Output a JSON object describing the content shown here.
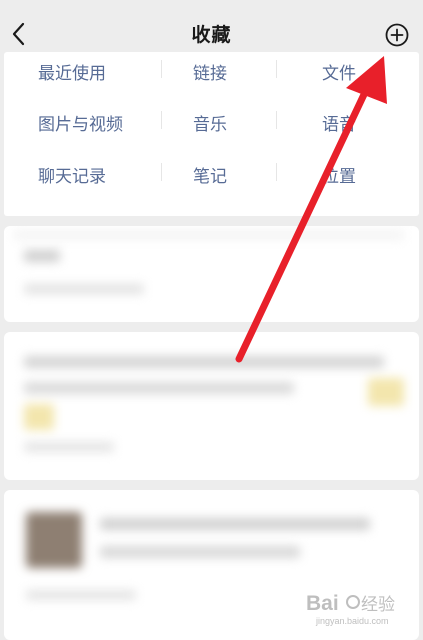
{
  "header": {
    "title": "收藏",
    "back_icon": "chevron-left-icon",
    "add_icon": "circle-plus-icon"
  },
  "categories": [
    {
      "label": "最近使用"
    },
    {
      "label": "链接"
    },
    {
      "label": "文件"
    },
    {
      "label": "图片与视频"
    },
    {
      "label": "音乐"
    },
    {
      "label": "语音"
    },
    {
      "label": "聊天记录"
    },
    {
      "label": "笔记"
    },
    {
      "label": "位置"
    }
  ],
  "annotation": {
    "arrow_color": "#e8202a"
  },
  "watermark": {
    "text": "Baidu经验",
    "url": "jingyan.baidu.com"
  },
  "colors": {
    "background": "#ededed",
    "category_text": "#576b95",
    "title_text": "#191919"
  }
}
